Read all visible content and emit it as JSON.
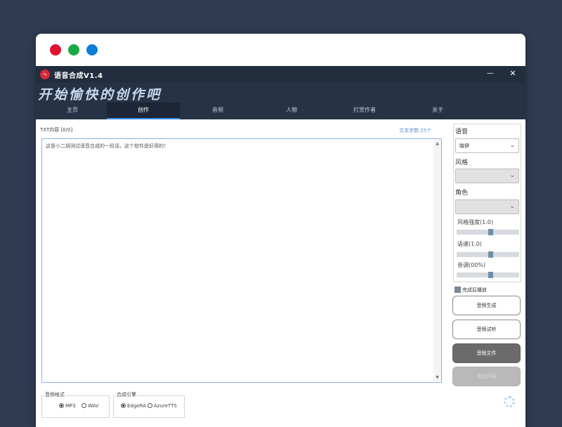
{
  "window": {
    "title": "语音合成V1.4",
    "app_icon": "audio-wave-icon",
    "minimize_glyph": "—",
    "close_glyph": "✕"
  },
  "banner": {
    "text": "开始愉快的创作吧"
  },
  "tabs": [
    {
      "label": "主页"
    },
    {
      "label": "创作"
    },
    {
      "label": "音频"
    },
    {
      "label": "人物"
    },
    {
      "label": "打赏作者"
    },
    {
      "label": "关于"
    }
  ],
  "active_tab": "创作",
  "editor": {
    "label": "TXT内容 [0/0]",
    "word_count": "文本字数:25个",
    "text": "这是小二胡测试语音合成的一段话，这个软件是好用的！"
  },
  "settings": {
    "voice_label": "语音",
    "voice_value": "晓伊",
    "style_label": "风格",
    "style_value": "",
    "role_label": "角色",
    "role_value": "",
    "style_strength_label": "风格强度(1.0)",
    "style_strength_value": 0.55,
    "speed_label": "语速(1.0)",
    "speed_value": 0.55,
    "pitch_label": "音调(00%)",
    "pitch_value": 0.55
  },
  "play_after_done": {
    "label": "完成后播放",
    "checked": true
  },
  "buttons": {
    "generate": "音频生成",
    "preview": "音频试听",
    "audio_file": "音频文件",
    "add_content": "添加内容"
  },
  "audio_format": {
    "title": "音频格式",
    "options": [
      "MP3",
      "WAV"
    ],
    "selected": "MP3"
  },
  "engine": {
    "title": "合成引擎",
    "options": [
      "EdgeRA",
      "AzureTTS"
    ],
    "selected": "EdgeRA"
  },
  "colors": {
    "titlebar": "#222d3d",
    "accent": "#3a8ee6",
    "background": "#2f3b52"
  }
}
